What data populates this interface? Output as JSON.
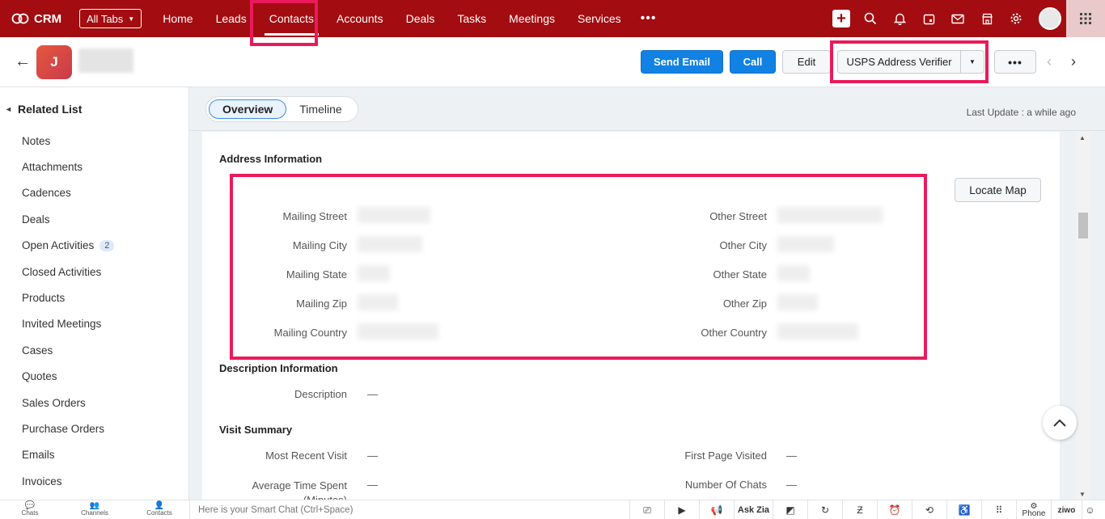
{
  "topnav": {
    "app_name": "CRM",
    "all_tabs": "All Tabs",
    "items": [
      "Home",
      "Leads",
      "Contacts",
      "Accounts",
      "Deals",
      "Tasks",
      "Meetings",
      "Services"
    ],
    "active": "Contacts",
    "more": "•••"
  },
  "record": {
    "avatar_initial": "J",
    "buttons": {
      "send_email": "Send Email",
      "call": "Call",
      "edit": "Edit",
      "usps": "USPS Address Verifier",
      "more": "•••"
    }
  },
  "sidebar": {
    "title": "Related List",
    "items": [
      {
        "label": "Notes"
      },
      {
        "label": "Attachments"
      },
      {
        "label": "Cadences"
      },
      {
        "label": "Deals"
      },
      {
        "label": "Open Activities",
        "badge": "2"
      },
      {
        "label": "Closed Activities"
      },
      {
        "label": "Products"
      },
      {
        "label": "Invited Meetings"
      },
      {
        "label": "Cases"
      },
      {
        "label": "Quotes"
      },
      {
        "label": "Sales Orders"
      },
      {
        "label": "Purchase Orders"
      },
      {
        "label": "Emails"
      },
      {
        "label": "Invoices"
      }
    ]
  },
  "tabs": {
    "overview": "Overview",
    "timeline": "Timeline"
  },
  "last_update": "Last Update : a while ago",
  "address": {
    "title": "Address Information",
    "locate_map": "Locate Map",
    "left": [
      "Mailing Street",
      "Mailing City",
      "Mailing State",
      "Mailing Zip",
      "Mailing Country"
    ],
    "right": [
      "Other Street",
      "Other City",
      "Other State",
      "Other Zip",
      "Other Country"
    ]
  },
  "description": {
    "title": "Description Information",
    "label": "Description",
    "value": "—"
  },
  "visit": {
    "title": "Visit Summary",
    "most_recent": "Most Recent Visit",
    "avg_time": "Average Time Spent (Minutes)",
    "first_page": "First Page Visited",
    "num_chats": "Number Of Chats",
    "dash": "—"
  },
  "bottombar": {
    "chats": "Chats",
    "channels": "Channels",
    "contacts": "Contacts",
    "smartchat": "Here is your Smart Chat (Ctrl+Space)",
    "ask_zia": "Ask Zia",
    "phone": "Phone",
    "ziwo": "ziwo"
  }
}
